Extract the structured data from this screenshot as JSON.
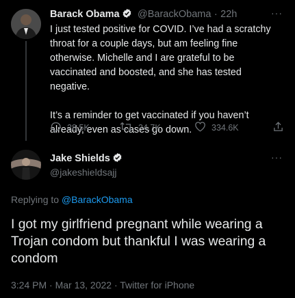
{
  "tweet1": {
    "name": "Barack Obama",
    "handle": "@BarackObama",
    "sep": "·",
    "time": "22h",
    "more": "···",
    "para1": "I just tested positive for COVID. I’ve had a scratchy throat for a couple days, but am feeling fine otherwise. Michelle and I are grateful to be vaccinated and boosted, and she has tested negative.",
    "para2": "It’s a reminder to get vaccinated if you haven’t already, even as cases go down.",
    "replies": "28.5K",
    "retweets": "34.7K",
    "likes": "334.6K"
  },
  "tweet2": {
    "name": "Jake Shields",
    "handle": "@jakeshieldsajj",
    "more": "···",
    "replying_prefix": "Replying to",
    "replying_handle": "@BarackObama",
    "text": "I got my girlfriend pregnant while wearing a Trojan condom but thankful I was wearing a condom",
    "timestamp": "3:24 PM · Mar 13, 2022 · Twitter for iPhone"
  },
  "colors": {
    "background": "#000000",
    "text": "#e7e9ea",
    "muted": "#71767b",
    "accent": "#1d9bf0"
  }
}
